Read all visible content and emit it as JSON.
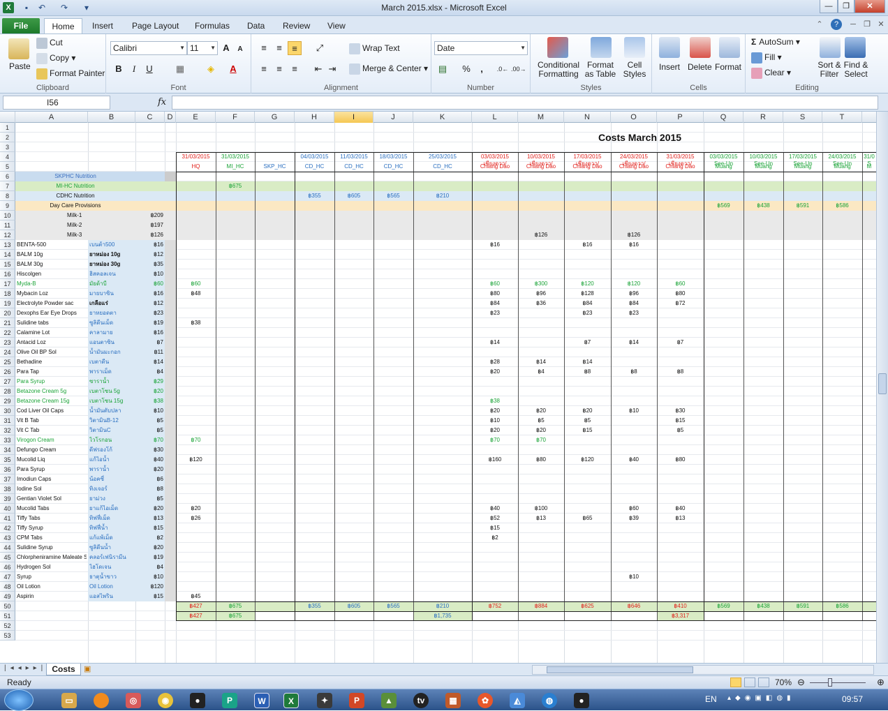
{
  "window": {
    "title": "March 2015.xlsx - Microsoft Excel",
    "file_icon": "X"
  },
  "ribbon_tabs": [
    "File",
    "Home",
    "Insert",
    "Page Layout",
    "Formulas",
    "Data",
    "Review",
    "View"
  ],
  "clipboard": {
    "paste": "Paste",
    "cut": "Cut",
    "copy": "Copy",
    "format_painter": "Format Painter",
    "label": "Clipboard"
  },
  "font": {
    "name": "Calibri",
    "size": "11",
    "label": "Font",
    "bold": "B",
    "italic": "I",
    "underline": "U",
    "grow": "A",
    "shrink": "A"
  },
  "alignment": {
    "wrap": "Wrap Text",
    "merge": "Merge & Center",
    "label": "Alignment"
  },
  "number": {
    "format": "Date",
    "label": "Number",
    "percent": "%",
    "comma": ","
  },
  "styles": {
    "cond": "Conditional Formatting",
    "table": "Format as Table",
    "cell": "Cell Styles",
    "label": "Styles"
  },
  "cells": {
    "insert": "Insert",
    "delete": "Delete",
    "format": "Format",
    "label": "Cells"
  },
  "editing": {
    "autosum": "AutoSum",
    "fill": "Fill",
    "clear": "Clear",
    "sort": "Sort & Filter",
    "find": "Find & Select",
    "label": "Editing",
    "sigma": "Σ"
  },
  "formula_bar": {
    "name_box": "I56",
    "fx": "fx",
    "formula": ""
  },
  "columns": [
    "A",
    "B",
    "C",
    "D",
    "E",
    "F",
    "G",
    "H",
    "I",
    "J",
    "K",
    "L",
    "M",
    "N",
    "O",
    "P",
    "Q",
    "R",
    "S",
    "T"
  ],
  "sheet": {
    "title": "Costs March 2015",
    "dates": [
      "31/03/2015",
      "31/03/2015",
      "",
      "04/03/2015",
      "11/03/2015",
      "18/03/2015",
      "25/03/2015",
      "03/03/2015",
      "10/03/2015",
      "17/03/2015",
      "24/03/2015",
      "31/03/2015",
      "03/03/2015",
      "10/03/2015",
      "17/03/2015",
      "24/03/2015",
      "31/0"
    ],
    "sub1": [
      "",
      "",
      "",
      "",
      "",
      "",
      "",
      "เชียงดาว/",
      "เชียงดาว/",
      "เชียงดาว/",
      "เชียงดาว/",
      "เชียงดาว/",
      "See-Un",
      "See-Un",
      "See-Un",
      "See-Un",
      "S"
    ],
    "sub2": [
      "HQ",
      "MI_HC",
      "SKP_HC",
      "CD_HC",
      "CD_HC",
      "CD_HC",
      "CD_HC",
      "Chiang Dao",
      "Chiang Dao",
      "Chiang Dao",
      "Chiang Dao",
      "Chiang Dao",
      "Muang",
      "Muang",
      "Muang",
      "Muang",
      "M"
    ],
    "cats": [
      "SKPHC Nutrition",
      "MI-HC Nutrition",
      "CDHC Nutrition",
      "Day Care Provisions"
    ],
    "milk": [
      [
        "Milk-1",
        "฿209"
      ],
      [
        "Milk-2",
        "฿197"
      ],
      [
        "Milk-3",
        "฿126"
      ]
    ],
    "items": [
      [
        "BENTA-500",
        "เบนต้า500",
        "฿16"
      ],
      [
        "BALM 10g",
        "ยาหม่อง  10g",
        "฿12"
      ],
      [
        "BALM 30g",
        "ยาหม่อง  30g",
        "฿35"
      ],
      [
        "Hiscolgen",
        "ฮิสคอลเจน",
        "฿10"
      ],
      [
        "Myda-B",
        "มัยด้าบี",
        "฿60"
      ],
      [
        "Mybacin Loz",
        "มายบาซิน",
        "฿16"
      ],
      [
        "Electrolyte Powder sac",
        "เกลือแร่",
        "฿12"
      ],
      [
        "Dexophs Ear Eye Drops",
        "ยาหยอดตา",
        "฿23"
      ],
      [
        "Sulidine tabs",
        "ซูลิดีนเม็ด",
        "฿19"
      ],
      [
        "Calamine Lot",
        "คาลามาย",
        "฿16"
      ],
      [
        "Antacid Loz",
        "แอนตาซิน",
        "฿7"
      ],
      [
        "Olive Oil BP Sol",
        "น้ำมันมะกอก",
        "฿11"
      ],
      [
        "Bethadine",
        "เบตาดีน",
        "฿14"
      ],
      [
        "Para Tap",
        "พาราเม็ด",
        "฿4"
      ],
      [
        "Para Syrup",
        "ซาราน้ำ",
        "฿29"
      ],
      [
        "Betazone Cream 5g",
        "เบตาโซน   5g",
        "฿20"
      ],
      [
        "Betazone Cream 15g",
        "เบตาโซน   15g",
        "฿38"
      ],
      [
        "Cod Liver Oil Caps",
        "น้ำมันตับปลา",
        "฿10"
      ],
      [
        "Vit B Tab",
        "วิตามินB-12",
        "฿5"
      ],
      [
        "Vit C Tab",
        "วิตามินC",
        "฿5"
      ],
      [
        "Virogon Cream",
        "ไวโรกอน",
        "฿70"
      ],
      [
        "Defungo Cream",
        "ดีฟรองโก้",
        "฿30"
      ],
      [
        "Mucolid Liq",
        "แก้ไอน้ำ",
        "฿40"
      ],
      [
        "Para Syrup",
        "พาราน้ำ",
        "฿20"
      ],
      [
        "Imodiun Caps",
        "น้อคซี่",
        "฿6"
      ],
      [
        "Iodine Sol",
        "ทิงเจอร์",
        "฿8"
      ],
      [
        "Gentian Violet Sol",
        "ยาม่วง",
        "฿5"
      ],
      [
        "Mucolid Tabs",
        "ยาแก้ไอเม็ด",
        "฿20"
      ],
      [
        "Tiffy Tabs",
        "ทิฟฟี่เม็ด",
        "฿13"
      ],
      [
        "Tiffy Syrup",
        "ทิฟฟี่น้ำ",
        "฿15"
      ],
      [
        "CPM Tabs",
        "แก้แพ้เม็ด",
        "฿2"
      ],
      [
        "Sulidine Syrup",
        "ซูลิดีนน้ำ",
        "฿20"
      ],
      [
        "Chlorpheniramine Maleate S",
        "คลอร์เฟนิรามีน",
        "฿19"
      ],
      [
        "Hydrogen Sol",
        "ไฮโดเจน",
        "฿4"
      ],
      [
        "Syrup",
        "ธาตุน้ำขาว",
        "฿10"
      ],
      [
        "Oil Lotion",
        "Oil Lotion",
        "฿120"
      ],
      [
        "Aspirin",
        "แอสไพริน",
        "฿15"
      ]
    ],
    "vals": {
      "F7": "฿675",
      "H8": "฿355",
      "I8": "฿605",
      "J8": "฿565",
      "K8": "฿210",
      "Q9": "฿569",
      "R9": "฿438",
      "S9": "฿591",
      "T9": "฿586",
      "M12": "฿126",
      "O12": "฿126",
      "L13": "฿16",
      "N13": "฿16",
      "O13": "฿16",
      "E17": "฿60",
      "L17": "฿60",
      "M17": "฿300",
      "N17": "฿120",
      "O17": "฿120",
      "P17": "฿60",
      "E18": "฿48",
      "L18": "฿80",
      "M18": "฿96",
      "N18": "฿128",
      "O18": "฿96",
      "P18": "฿80",
      "L19": "฿84",
      "M19": "฿36",
      "N19": "฿84",
      "O19": "฿84",
      "P19": "฿72",
      "L20": "฿23",
      "N20": "฿23",
      "O20": "฿23",
      "E21": "฿38",
      "L23": "฿14",
      "N23": "฿7",
      "O23": "฿14",
      "P23": "฿7",
      "L25": "฿28",
      "M25": "฿14",
      "N25": "฿14",
      "L26": "฿20",
      "M26": "฿4",
      "N26": "฿8",
      "O26": "฿8",
      "P26": "฿8",
      "L29": "฿38",
      "L30": "฿20",
      "M30": "฿20",
      "N30": "฿20",
      "O30": "฿10",
      "P30": "฿30",
      "L31": "฿10",
      "M31": "฿5",
      "N31": "฿5",
      "P31": "฿15",
      "L32": "฿20",
      "M32": "฿20",
      "N32": "฿15",
      "P32": "฿5",
      "E33": "฿70",
      "L33": "฿70",
      "M33": "฿70",
      "E35": "฿120",
      "L35": "฿160",
      "M35": "฿80",
      "N35": "฿120",
      "O35": "฿40",
      "P35": "฿80",
      "E40": "฿20",
      "L40": "฿40",
      "M40": "฿100",
      "O40": "฿60",
      "P40": "฿40",
      "E41": "฿26",
      "L41": "฿52",
      "M41": "฿13",
      "N41": "฿65",
      "O41": "฿39",
      "P41": "฿13",
      "L42": "฿15",
      "L43": "฿2",
      "O47": "฿10",
      "E49": "฿45"
    },
    "totals50": {
      "E": "฿427",
      "F": "฿675",
      "H": "฿355",
      "I": "฿605",
      "J": "฿565",
      "K": "฿210",
      "L": "฿752",
      "M": "฿884",
      "N": "฿625",
      "O": "฿646",
      "P": "฿410",
      "Q": "฿569",
      "R": "฿438",
      "S": "฿591",
      "T": "฿586"
    },
    "totals51": {
      "E": "฿427",
      "F": "฿675",
      "K": "฿1,735",
      "P": "฿3,317"
    }
  },
  "sheet_tab": "Costs",
  "status": {
    "ready": "Ready",
    "zoom": "70%"
  },
  "taskbar": {
    "lang": "EN",
    "time": "09:57"
  },
  "colors": {
    "red": "#e0201b",
    "green": "#1aa337",
    "blue": "#2a6fc0",
    "grey": "#e9e9e9",
    "lightblue": "#dbe9f5",
    "lightgreen": "#d9ecc5",
    "peach": "#fbe8c3",
    "band": "#c9dcef"
  }
}
